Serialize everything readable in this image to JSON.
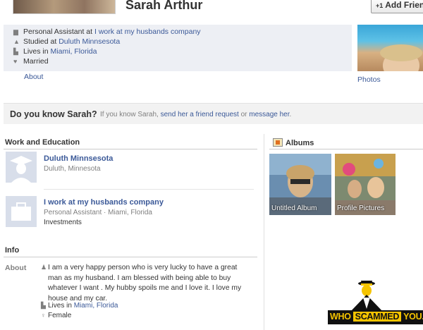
{
  "header": {
    "name": "Sarah Arthur",
    "add_friend_label": "Add Friend",
    "add_friend_icon": "+1"
  },
  "intro": {
    "work": {
      "icon": "briefcase-icon",
      "prefix": "Personal Assistant at ",
      "link": "I work at my husbands company"
    },
    "education": {
      "icon": "graduation-cap-icon",
      "prefix": "Studied at ",
      "link": "Duluth Minnsesota"
    },
    "location": {
      "icon": "building-icon",
      "prefix": "Lives in ",
      "link": "Miami, Florida"
    },
    "relationship": {
      "icon": "heart-icon",
      "text": "Married"
    },
    "about_link": "About",
    "photos_link": "Photos"
  },
  "do_you_know": {
    "title": "Do you know Sarah?",
    "prefix": "If you know Sarah, ",
    "link1": "send her a friend request",
    "middle": " or ",
    "link2": "message her",
    "suffix": "."
  },
  "work_education": {
    "heading": "Work and Education",
    "items": [
      {
        "title": "Duluth Minnsesota",
        "subtitle": "Duluth, Minnesota",
        "detail": "",
        "icon": "school-silhouette-icon"
      },
      {
        "title": "I work at my husbands company",
        "subtitle": "Personal Assistant · Miami, Florida",
        "detail": "Investments",
        "icon": "briefcase-icon"
      }
    ]
  },
  "albums": {
    "heading": "Albums",
    "icon": "albums-icon",
    "items": [
      {
        "label": "Untitled Album"
      },
      {
        "label": "Profile Pictures"
      }
    ]
  },
  "info": {
    "heading": "Info",
    "about_label": "About",
    "bio": "I am a very happy person who is very lucky to have a great man as my husband. I am blessed with being able to buy whatever I want . My hubby spoils me and I love it. I love my house and my car.",
    "lives_prefix": "Lives in ",
    "lives_link": "Miami, Florida",
    "gender": "Female"
  },
  "watermark": {
    "part1": "WHO",
    "part2": "SCAMMED",
    "part3": "YOU.COM"
  },
  "colors": {
    "link": "#3b5998",
    "intro_bg": "#edeff4",
    "watermark_yellow": "#f5c400"
  }
}
